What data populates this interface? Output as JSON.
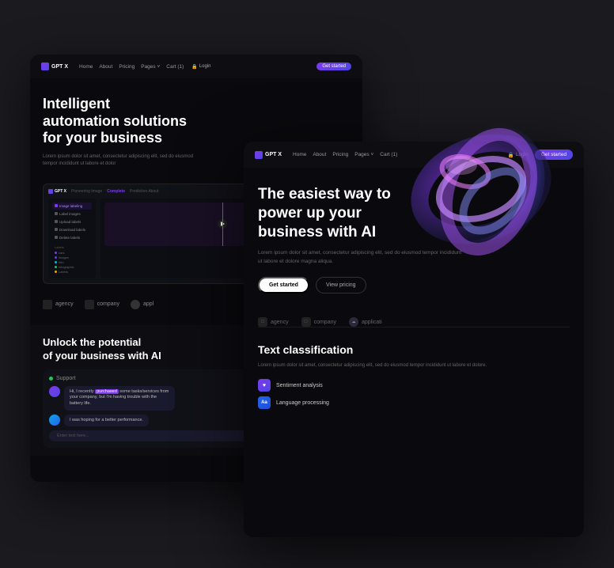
{
  "back_card": {
    "navbar": {
      "logo_text": "GPT X",
      "nav_items": [
        "Home",
        "About",
        "Pricing",
        "Pages ˅",
        "Cart (1)"
      ],
      "login_label": "Login",
      "cta_label": "Get started"
    },
    "hero": {
      "title_line1": "Intelligent",
      "title_line2": "automation solutions",
      "title_line3": "for your business",
      "subtitle": "Lorem ipsum dolor sit amet, consectetur adipiscing elit, sed do eiusmod tempor incididunt ut labore et dolor"
    },
    "dashboard": {
      "logo": "GPT X",
      "tabs": [
        "Pioneering Image",
        "Complete",
        "Prediction About"
      ],
      "sidebar_items": [
        "Image labeling",
        "Label images",
        "Upload labels",
        "Download labels",
        "Delete labels"
      ],
      "labels_section": {
        "title": "Labels",
        "items": [
          {
            "label": "cars",
            "color": "#7c3aed"
          },
          {
            "label": "images",
            "color": "#4f46e5"
          },
          {
            "label": "info",
            "color": "#06b6d4"
          },
          {
            "label": "infographic",
            "color": "#22c55e"
          },
          {
            "label": "Labels",
            "color": "#f59e0b"
          }
        ]
      }
    },
    "brands": [
      {
        "icon": "□",
        "label": "agency"
      },
      {
        "icon": "□",
        "label": "company"
      },
      {
        "icon": "☁",
        "label": "appl"
      }
    ],
    "bottom_section": {
      "title_line1": "Unlock the potential",
      "title_line2": "of your business with AI"
    },
    "chat_preview": {
      "header": "Support",
      "message1": "Hi, I recently purchased some tasks/services from your company, but I'm having trouble with the battery life.",
      "highlighted_word": "purchased",
      "message2": "I was hoping for a better performance.",
      "input_placeholder": "Enter text here..."
    }
  },
  "front_card": {
    "navbar": {
      "logo_text": "GPT X",
      "nav_items": [
        "Home",
        "About",
        "Pricing",
        "Pages ˅",
        "Cart (1)"
      ],
      "login_label": "Login",
      "cta_label": "Get started"
    },
    "hero": {
      "title_line1": "The easiest way to",
      "title_line2": "power up your",
      "title_line3": "business with AI",
      "subtitle": "Lorem ipsum dolor sit amet, consectetur adipiscing elit, sed do eiusmod tempor incididunt ut labore et dolore magna aliqua.",
      "btn_primary": "Get started",
      "btn_secondary": "View pricing"
    },
    "brands": [
      {
        "icon": "□",
        "label": "agency"
      },
      {
        "icon": "□",
        "label": "company"
      },
      {
        "icon": "☁",
        "label": "applicati"
      }
    ],
    "text_classification": {
      "title": "Text classification",
      "subtitle": "Lorem ipsum dolor sit amet, consectetur adipiscing elit, sed do eiusmod tempor incididunt ut labore et dolore.",
      "features": [
        {
          "icon": "♥",
          "label": "Sentiment analysis",
          "badge_color": "purple"
        },
        {
          "icon": "Aa",
          "label": "Language processing",
          "badge_color": "blue"
        }
      ]
    }
  }
}
